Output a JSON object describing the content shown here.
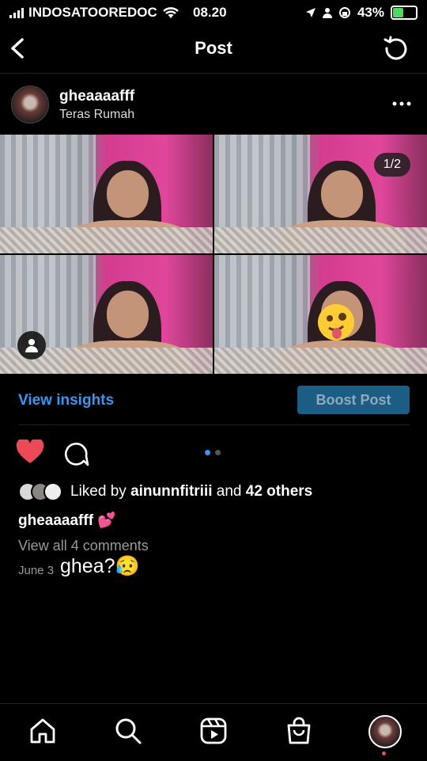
{
  "status_bar": {
    "carrier": "INDOSATOOREDOC",
    "time": "08.20",
    "battery_percent": "43%",
    "battery_level": 0.43,
    "icons": [
      "signal-icon",
      "wifi-icon",
      "location-icon",
      "person-icon",
      "lock-rotation-icon",
      "battery-charging-icon"
    ]
  },
  "header": {
    "title": "Post"
  },
  "post": {
    "username": "gheaaaafff",
    "location": "Teras Rumah",
    "image_counter": "1/2",
    "insights_label": "View insights",
    "boost_label": "Boost Post",
    "liked_by_prefix": "Liked by",
    "liked_by_user": "ainunnfitriii",
    "liked_by_and": "and",
    "liked_by_others": "42 others",
    "caption_user": "gheaaaafff",
    "caption_text": "💕",
    "view_comments": "View all 4 comments",
    "date": "June 3",
    "liked": true,
    "carousel_index": 1,
    "carousel_total": 2
  },
  "overlay_text": "ghea?😥",
  "colors": {
    "accent": "#3897f0",
    "like": "#ed4956",
    "boost_bg": "#1c5d86"
  }
}
